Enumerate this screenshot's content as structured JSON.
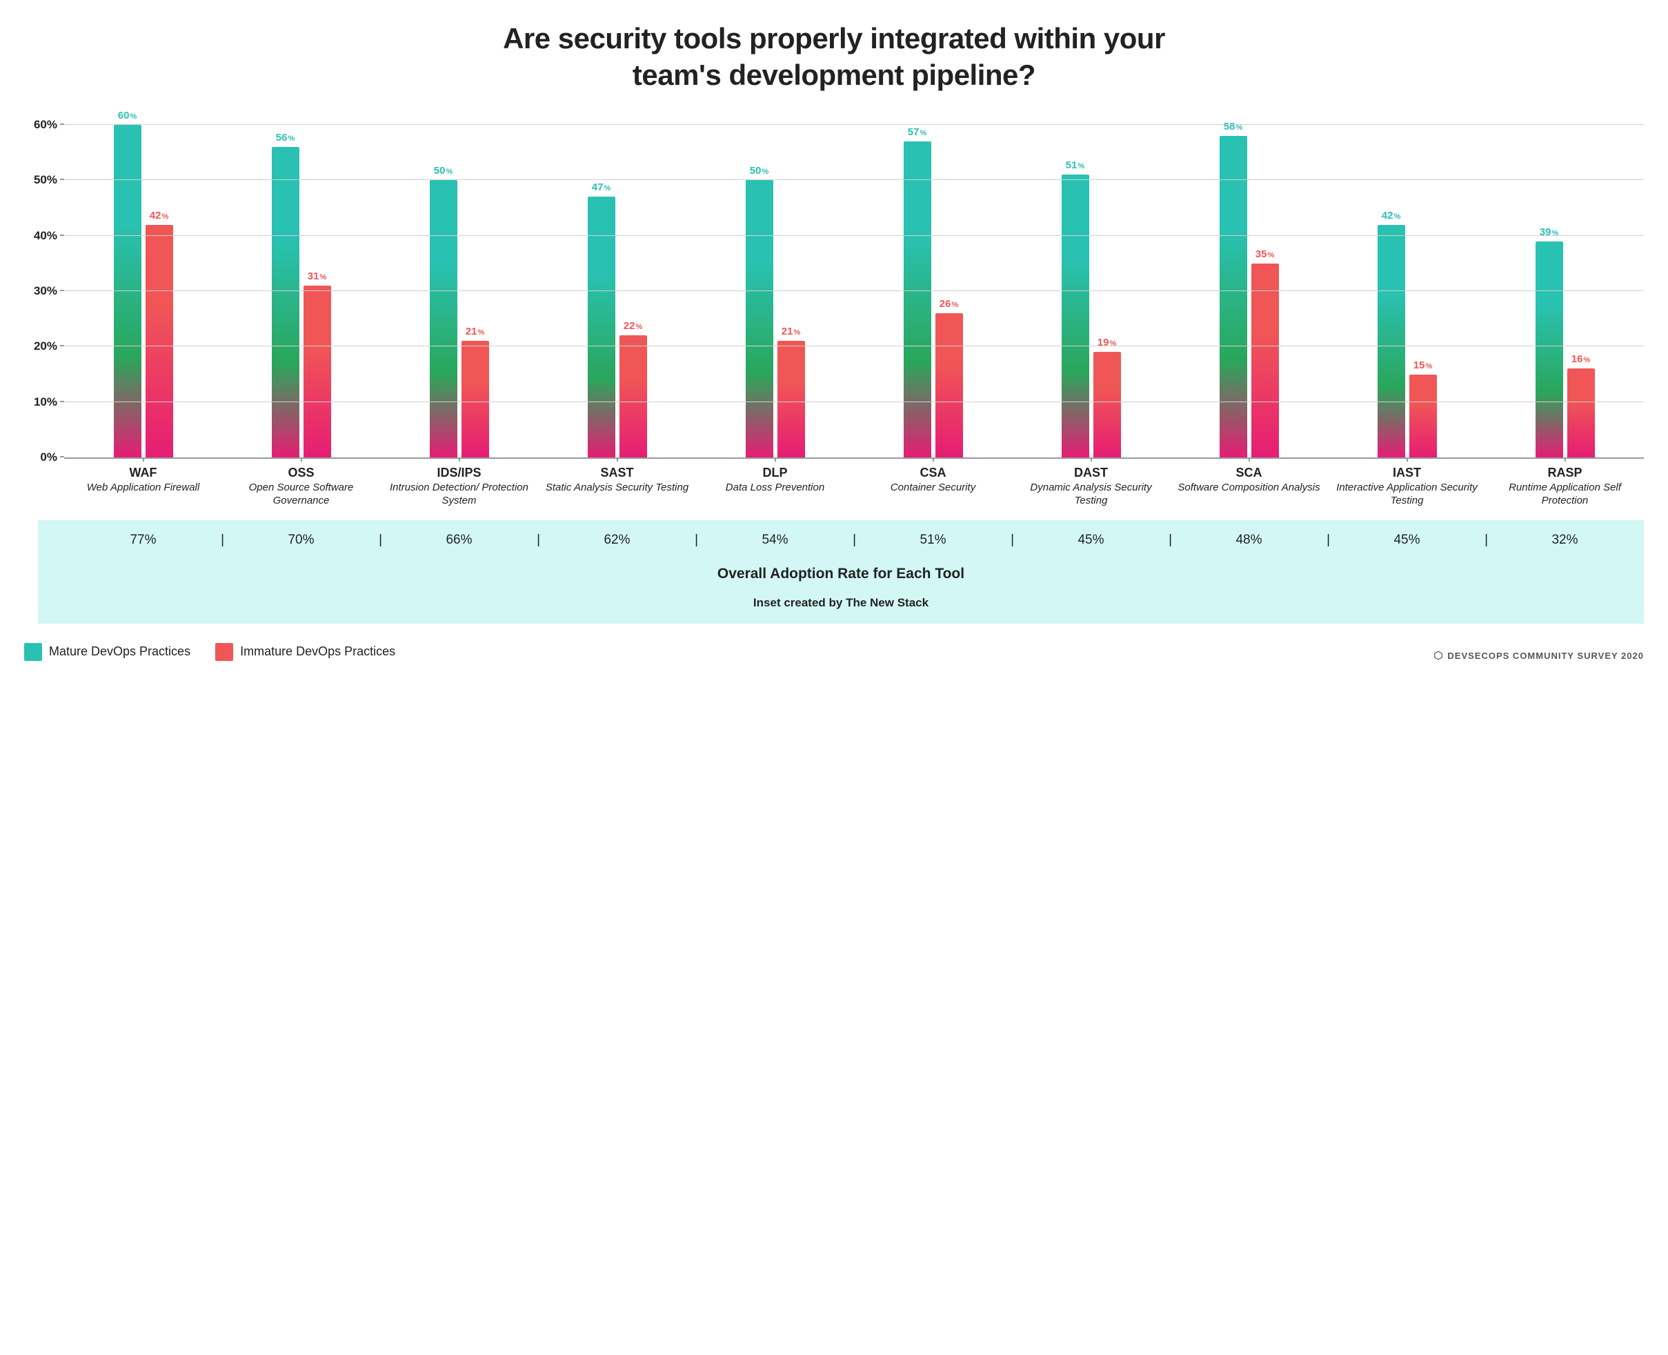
{
  "chart_data": {
    "type": "bar",
    "title": "Are security tools properly integrated within your team's development pipeline?",
    "ylabel": "",
    "ylim": [
      0,
      62
    ],
    "yticks": [
      0,
      10,
      20,
      30,
      40,
      50,
      60
    ],
    "categories": [
      "WAF",
      "OSS",
      "IDS/IPS",
      "SAST",
      "DLP",
      "CSA",
      "DAST",
      "SCA",
      "IAST",
      "RASP"
    ],
    "category_full": [
      "Web Application Firewall",
      "Open Source Software Governance",
      "Intrusion Detection/ Protection System",
      "Static Analysis Security Testing",
      "Data Loss Prevention",
      "Container Security",
      "Dynamic Analysis Security Testing",
      "Software Composition Analysis",
      "Interactive Application Security Testing",
      "Runtime Application Self Protection"
    ],
    "series": [
      {
        "name": "Mature DevOps Practices",
        "values": [
          60,
          56,
          50,
          47,
          50,
          57,
          51,
          58,
          42,
          39
        ]
      },
      {
        "name": "Immature DevOps Practices",
        "values": [
          42,
          31,
          21,
          22,
          21,
          26,
          19,
          35,
          15,
          16
        ]
      }
    ],
    "overall_adoption": [
      77,
      70,
      66,
      62,
      54,
      51,
      45,
      48,
      45,
      32
    ],
    "adoption_title": "Overall Adoption Rate for Each Tool",
    "inset_credit": "Inset created by The New Stack",
    "source": "DEVSECOPS COMMUNITY SURVEY 2020"
  },
  "colors": {
    "mature": "#29c1b1",
    "immature": "#f05656",
    "grid": "#d0d0d0",
    "band": "#d2f7f5"
  }
}
